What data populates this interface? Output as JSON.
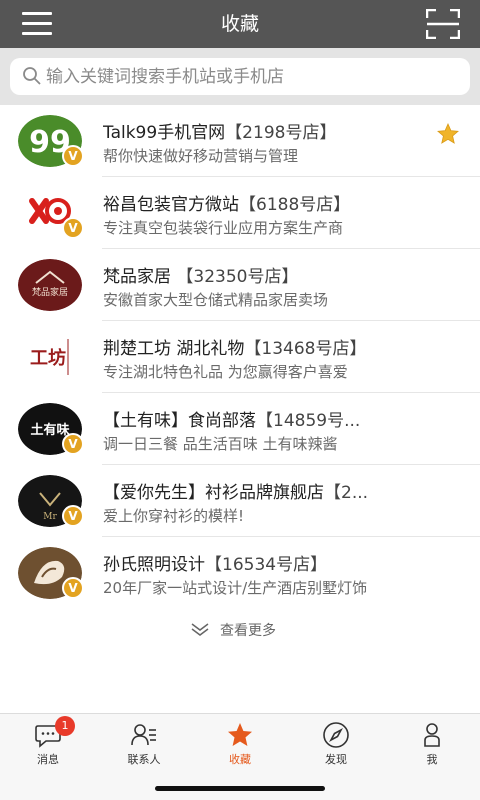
{
  "header": {
    "title": "收藏",
    "menu_icon": "menu-icon",
    "scan_icon": "scan-icon"
  },
  "search": {
    "placeholder": "输入关键词搜索手机站或手机店",
    "value": ""
  },
  "stores": [
    {
      "name": "Talk99手机官网",
      "number": "【2198号店】",
      "desc": "帮你快速做好移动营销与管理",
      "verified": true,
      "starred": true,
      "logo_text": "99"
    },
    {
      "name": "裕昌包装官方微站",
      "number": "【6188号店】",
      "desc": "专注真空包装袋行业应用方案生产商",
      "verified": true,
      "starred": false,
      "logo_text": ""
    },
    {
      "name": "梵品家居",
      "number": "  【32350号店】",
      "desc": "安徽首家大型仓储式精品家居卖场",
      "verified": false,
      "starred": false,
      "logo_text": "梵品家居"
    },
    {
      "name": "荆楚工坊 湖北礼物",
      "number": "【13468号店】",
      "desc": "专注湖北特色礼品 为您赢得客户喜爱",
      "verified": false,
      "starred": false,
      "logo_text": "工坊"
    },
    {
      "name": "【土有味】食尚部落",
      "number": "【14859号...",
      "desc": "调一日三餐 品生活百味 土有味辣酱",
      "verified": true,
      "starred": false,
      "logo_text": "土有味"
    },
    {
      "name": "【爱你先生】衬衫品牌旗舰店",
      "number": "【2...",
      "desc": "爱上你穿衬衫的模样!",
      "verified": true,
      "starred": false,
      "logo_text": "Mr"
    },
    {
      "name": "孙氏照明设计",
      "number": "【16534号店】",
      "desc": "20年厂家一站式设计/生产酒店别墅灯饰",
      "verified": true,
      "starred": false,
      "logo_text": ""
    }
  ],
  "verified_label": "V",
  "more": {
    "label": "查看更多"
  },
  "tabs": [
    {
      "label": "消息",
      "icon": "chat-icon",
      "badge": "1"
    },
    {
      "label": "联系人",
      "icon": "contacts-icon"
    },
    {
      "label": "收藏",
      "icon": "star-icon",
      "active": true
    },
    {
      "label": "发现",
      "icon": "compass-icon"
    },
    {
      "label": "我",
      "icon": "person-icon"
    }
  ],
  "colors": {
    "topbar": "#555555",
    "accent": "#e55a1d",
    "badge": "#e83a2a",
    "verified": "#e3a321",
    "star": "#f0b429"
  }
}
